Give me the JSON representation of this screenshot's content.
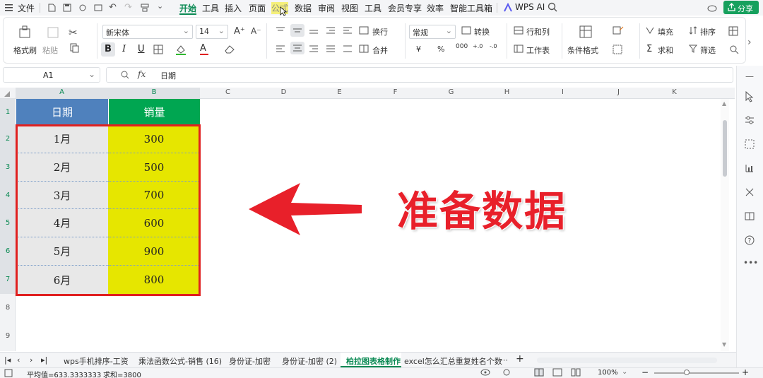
{
  "menu": {
    "file": "文件",
    "tabs": [
      "开始",
      "工具",
      "插入",
      "页面",
      "公式",
      "数据",
      "审阅",
      "视图",
      "工具",
      "会员专享",
      "效率",
      "智能工具箱"
    ],
    "wps_ai": "WPS AI",
    "share": "分享"
  },
  "ribbon": {
    "format_painter": "格式刷",
    "paste": "粘贴",
    "font_name": "新宋体",
    "font_size": "14",
    "wrap": "换行",
    "merge": "合并",
    "number_format": "常规",
    "convert": "转换",
    "row_col": "行和列",
    "worksheet": "工作表",
    "cond_format": "条件格式",
    "fill": "填充",
    "sort": "排序",
    "sum": "求和",
    "filter": "筛选",
    "currency": "¥",
    "percent": "%"
  },
  "formula_bar": {
    "cell_ref": "A1",
    "fx": "fx",
    "value": "日期"
  },
  "columns": [
    "A",
    "B",
    "C",
    "D",
    "E",
    "F",
    "G",
    "H",
    "I",
    "J",
    "K"
  ],
  "rows": [
    "1",
    "2",
    "3",
    "4",
    "5",
    "6",
    "7",
    "8",
    "9"
  ],
  "table": {
    "headers": [
      "日期",
      "销量"
    ],
    "rows": [
      [
        "1月",
        "300"
      ],
      [
        "2月",
        "500"
      ],
      [
        "3月",
        "700"
      ],
      [
        "4月",
        "600"
      ],
      [
        "5月",
        "900"
      ],
      [
        "6月",
        "800"
      ]
    ]
  },
  "annotation": "准备数据",
  "sheet_tabs": [
    {
      "label": "wps手机排序-工资",
      "active": false
    },
    {
      "label": "乘法函数公式-销售 (16)",
      "active": false
    },
    {
      "label": "身份证-加密",
      "active": false
    },
    {
      "label": "身份证-加密 (2)",
      "active": false
    },
    {
      "label": "柏拉图表格制作",
      "active": true
    },
    {
      "label": "excel怎么汇总重复姓名个数",
      "active": false
    }
  ],
  "status": {
    "average": "平均值=633.3333333",
    "sum": "求和=3800",
    "zoom": "100%"
  },
  "colors": {
    "header_a": "#4f81bd",
    "header_b": "#00a651",
    "data_b": "#e6e600",
    "data_a": "#e8e8e8",
    "accent": "#0b8a54",
    "highlight_border": "#e02020"
  }
}
